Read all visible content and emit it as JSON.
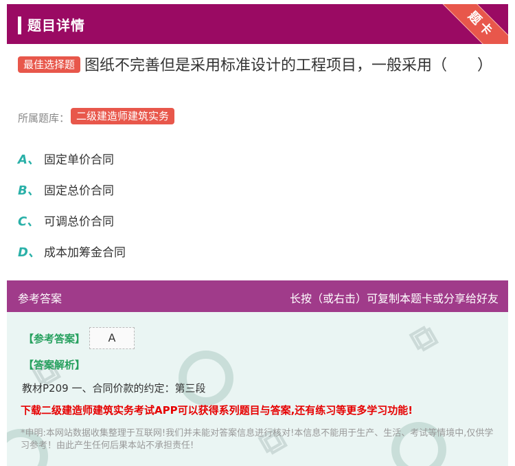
{
  "header": {
    "title": "题目详情",
    "ribbon": "题卡"
  },
  "question": {
    "tag": "最佳选择题",
    "text": "图纸不完善但是采用标准设计的工程项目，一般采用（　　）"
  },
  "source": {
    "label": "所属题库：",
    "tag": "二级建造师建筑实务"
  },
  "options": [
    {
      "letter": "A、",
      "text": "固定单价合同"
    },
    {
      "letter": "B、",
      "text": "固定总价合同"
    },
    {
      "letter": "C、",
      "text": "可调总价合同"
    },
    {
      "letter": "D、",
      "text": "成本加筹金合同"
    }
  ],
  "answer_section": {
    "title": "参考答案",
    "share_hint": "长按（或右击）可复制本题卡或分享给好友",
    "answer_label": "【参考答案】",
    "answer_value": "A",
    "explanation_label": "【答案解析】",
    "explanation": "教材P209 一、合同价款的约定：第三段",
    "promo": "下载二级建造师建筑实务考试APP可以获得系列题目与答案,还有练习等更多学习功能!",
    "disclaimer": "*申明:本网站数据收集整理于互联网!我们并未能对答案信息进行核对!本信息不能用于生产、生活、考试等情境中,仅供学习参考！由此产生任何后果本站不承担责任!"
  }
}
